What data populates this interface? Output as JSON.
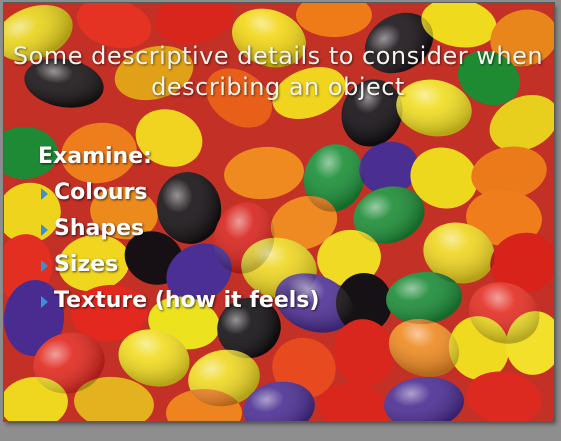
{
  "slide": {
    "title": "Some descriptive details to consider when describing an object",
    "heading": "Examine:",
    "bullets": [
      "Colours",
      "Shapes",
      "Sizes",
      "Texture (how it feels)"
    ],
    "bullet_icon": "triangle-bullet-icon",
    "background_image": "jelly-beans-photo"
  },
  "colors": {
    "viewer_background": "#8e8e8e",
    "bullet_accent": "#3a8fd6",
    "text": "#ffffff"
  }
}
